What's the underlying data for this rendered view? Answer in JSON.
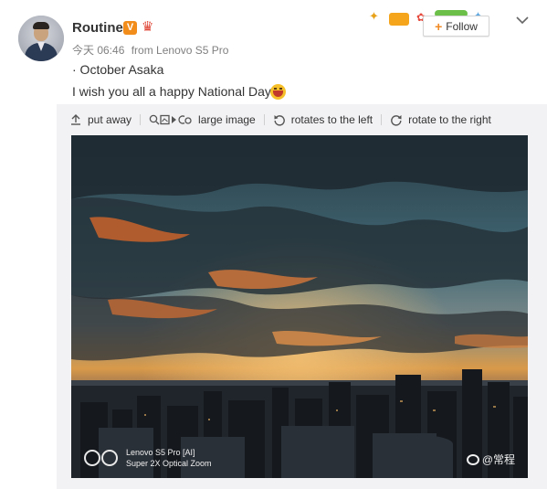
{
  "post": {
    "author": "Routine",
    "verified_badge": "V",
    "time": "今天 06:46",
    "source": "from Lenovo S5 Pro",
    "line1": "· October Asaka",
    "line2": "I wish you all a happy National Day",
    "follow_label": "Follow",
    "follow_plus": "+"
  },
  "toolbar": {
    "put_away": "put away",
    "large_image": "large image",
    "rotate_left": "rotates to the left",
    "rotate_right": "rotate to the right"
  },
  "photo": {
    "watermark_line1": "Lenovo S5 Pro [AI]",
    "watermark_line2": "Super 2X Optical Zoom",
    "credit": "@常程"
  },
  "colors": {
    "accent_orange": "#f08a24",
    "badge_orange": "#f28c1a",
    "toolbar_bg": "#f2f2f5"
  },
  "icons": [
    "avatar",
    "verified-badge-icon",
    "crown-icon",
    "plus-icon",
    "chevron-down-icon",
    "smile-emoji-icon",
    "arrow-up-icon",
    "search-image-icon",
    "rotate-left-icon",
    "rotate-right-icon",
    "camera-lens-icon",
    "weibo-icon"
  ]
}
